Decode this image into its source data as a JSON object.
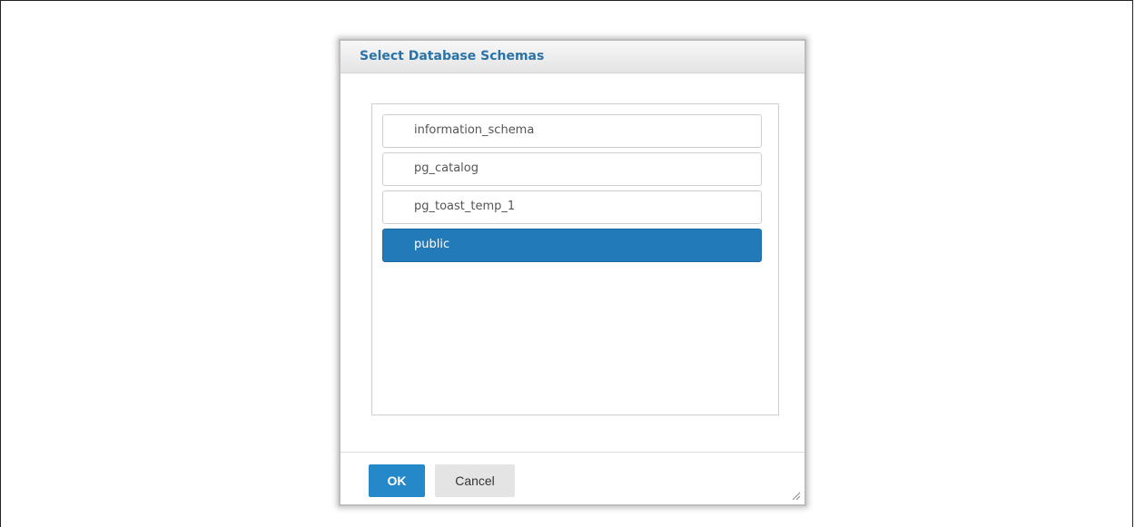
{
  "dialog": {
    "title": "Select Database Schemas",
    "schemas": [
      {
        "label": "information_schema",
        "selected": false
      },
      {
        "label": "pg_catalog",
        "selected": false
      },
      {
        "label": "pg_toast_temp_1",
        "selected": false
      },
      {
        "label": "public",
        "selected": true
      }
    ],
    "ok_label": "OK",
    "cancel_label": "Cancel",
    "resize_icon": "resize-grip-icon"
  },
  "colors": {
    "title": "#2a73a8",
    "selected_item": "#237ab8",
    "ok_button": "#2589c9",
    "cancel_button": "#e4e4e4"
  }
}
